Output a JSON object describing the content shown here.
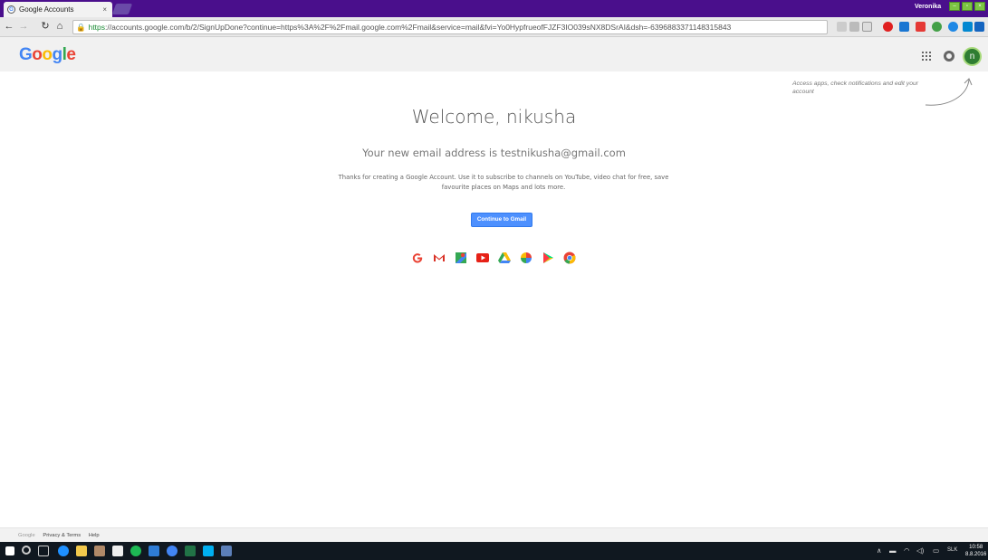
{
  "browser": {
    "tab_title": "Google Accounts",
    "tab_close": "×",
    "profile_name": "Veronika",
    "url_https": "https",
    "url_rest": "://accounts.google.com/b/2/SignUpDone?continue=https%3A%2F%2Fmail.google.com%2Fmail&service=mail&fvi=Yo0HypfrueofFJZF3IO039sNX8DSrAI&dsh=-6396883371148315843"
  },
  "header": {
    "logo": {
      "G": "G",
      "o1": "o",
      "o2": "o",
      "g": "g",
      "l": "l",
      "e": "e"
    },
    "avatar_letter": "n",
    "hint": "Access apps, check notifications and edit your account"
  },
  "main": {
    "welcome": "Welcome, nikusha",
    "new_address": "Your new email address is testnikusha@gmail.com",
    "description": "Thanks for creating a Google Account. Use it to subscribe to channels on YouTube, video chat for free, save favourite places on Maps and lots more.",
    "continue_button": "Continue to Gmail",
    "apps": [
      "google-search",
      "gmail",
      "maps",
      "youtube",
      "drive",
      "photos",
      "play",
      "chrome"
    ]
  },
  "footer": {
    "google": "Google",
    "privacy": "Privacy & Terms",
    "help": "Help"
  },
  "taskbar": {
    "language": "SLK",
    "time": "10:58",
    "date": "8.8.2016"
  },
  "colors": {
    "blue": "#4285f4",
    "red": "#ea4335",
    "yellow": "#fbbc05",
    "green": "#34a853",
    "button": "#4d90fe"
  }
}
